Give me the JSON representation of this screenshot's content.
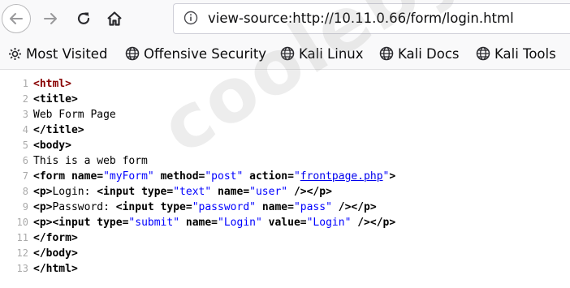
{
  "navbar": {
    "url": "view-source:http://10.11.0.66/form/login.html"
  },
  "bookmarks": [
    {
      "label": "Most Visited",
      "icon": "gear-icon"
    },
    {
      "label": "Offensive Security",
      "icon": "globe-icon"
    },
    {
      "label": "Kali Linux",
      "icon": "globe-icon"
    },
    {
      "label": "Kali Docs",
      "icon": "globe-icon"
    },
    {
      "label": "Kali Tools",
      "icon": "globe-icon"
    }
  ],
  "source": {
    "line_numbers": [
      "1",
      "2",
      "3",
      "4",
      "5",
      "6",
      "7",
      "8",
      "9",
      "10",
      "11",
      "12",
      "13"
    ],
    "line1": {
      "html_open": "<html>"
    },
    "line2": {
      "title_open": "<title>"
    },
    "line3": {
      "text": "Web Form Page"
    },
    "line4": {
      "title_close": "</title>"
    },
    "line5": {
      "body_open": "<body>"
    },
    "line6": {
      "text": "This is a web form"
    },
    "line7": {
      "t1": "<form",
      "a1": "name=",
      "v1": "\"myForm\"",
      "a2": "method=",
      "v2": "\"post\"",
      "a3": "action=",
      "q1": "\"",
      "link": "frontpage.php",
      "q2": "\"",
      "t2": ">"
    },
    "line8": {
      "t1": "<p>",
      "text": "Login: ",
      "t2": "<input",
      "a1": "type=",
      "v1": "\"text\"",
      "a2": "name=",
      "v2": "\"user\"",
      "t3": "/></p>"
    },
    "line9": {
      "t1": "<p>",
      "text": "Password: ",
      "t2": "<input",
      "a1": "type=",
      "v1": "\"password\"",
      "a2": "name=",
      "v2": "\"pass\"",
      "t3": "/></p>"
    },
    "line10": {
      "t1": "<p><input",
      "a1": "type=",
      "v1": "\"submit\"",
      "a2": "name=",
      "v2": "\"Login\"",
      "a3": "value=",
      "v3": "\"Login\"",
      "t2": "/></p>"
    },
    "line11": {
      "text": "</form>"
    },
    "line12": {
      "text": "</body>"
    },
    "line13": {
      "text": "</html>"
    }
  },
  "watermark": {
    "text": "cooleby.net"
  },
  "colors": {
    "tag_start": "#880000",
    "attr_value": "#0000ff",
    "link": "#0000ee",
    "line_number": "#aaaaaa"
  }
}
